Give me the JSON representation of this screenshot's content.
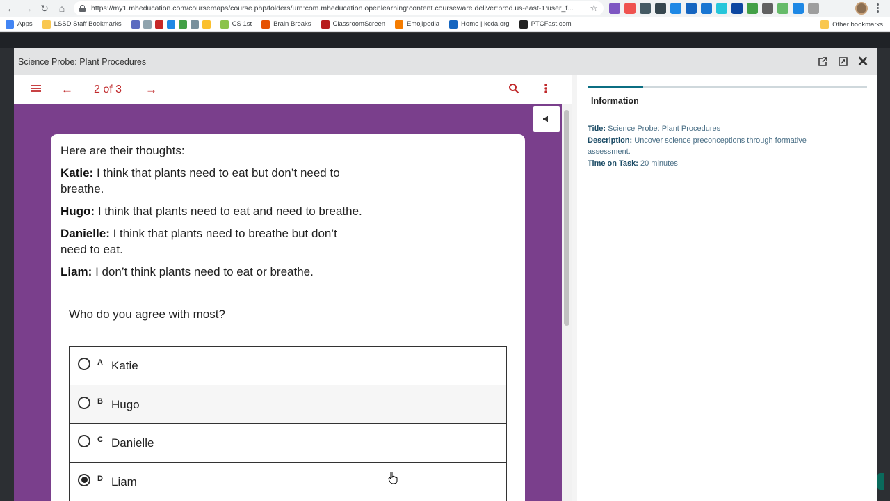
{
  "browser": {
    "url": "https://my1.mheducation.com/coursemaps/course.php/folders/urn:com.mheducation.openlearning:content.courseware.deliver:prod.us-east-1:user_f...",
    "bookmarks": [
      "Apps",
      "LSSD Staff Bookmarks",
      "CS 1st",
      "Brain Breaks",
      "ClassroomScreen",
      "Emojipedia",
      "Home | kcda.org",
      "PTCFast.com"
    ],
    "other_bookmarks": "Other bookmarks"
  },
  "modal": {
    "title": "Science Probe: Plant Procedures"
  },
  "toolbar": {
    "page_indicator": "2 of 3"
  },
  "content": {
    "intro": "Here are their thoughts:",
    "thoughts": [
      {
        "name": "Katie:",
        "text": " I think that plants need to eat but don’t need to breathe."
      },
      {
        "name": "Hugo:",
        "text": " I think that plants need to eat and need to breathe."
      },
      {
        "name": "Danielle:",
        "text": " I think that plants need to breathe but don’t need to eat."
      },
      {
        "name": "Liam:",
        "text": " I don’t think plants need to eat or breathe."
      }
    ],
    "question": "Who do you agree with most?",
    "choices": [
      {
        "letter": "A",
        "label": "Katie",
        "selected": false
      },
      {
        "letter": "B",
        "label": "Hugo",
        "selected": false
      },
      {
        "letter": "C",
        "label": "Danielle",
        "selected": false
      },
      {
        "letter": "D",
        "label": "Liam",
        "selected": true
      }
    ]
  },
  "info": {
    "tab_label": "Information",
    "title_label": "Title:",
    "title_value": " Science Probe: Plant Procedures",
    "description_label": "Description:",
    "description_value": " Uncover science preconceptions through formative assessment.",
    "time_label": "Time on Task:",
    "time_value": " 20 minutes"
  },
  "colors": {
    "accent_red": "#c0282a",
    "stage_purple": "#7a3f8c",
    "info_teal": "#0b6e82"
  }
}
